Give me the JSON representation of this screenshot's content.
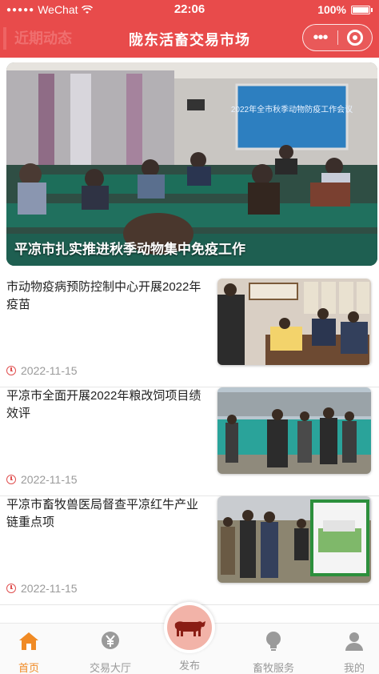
{
  "status_bar": {
    "carrier": "WeChat",
    "time": "22:06",
    "battery": "100%"
  },
  "header": {
    "title": "陇东活畜交易市场",
    "section_tag": "近期动态"
  },
  "hero": {
    "caption": "平凉市扎实推进秋季动物集中免疫工作",
    "screen_text": "2022年全市秋季动物防疫工作会议"
  },
  "news": [
    {
      "title": "市动物疫病预防控制中心开展2022年疫苗",
      "date": "2022-11-15"
    },
    {
      "title": "平凉市全面开展2022年粮改饲项目绩效评",
      "date": "2022-11-15"
    },
    {
      "title": "平凉市畜牧兽医局督查平凉红牛产业链重点项",
      "date": "2022-11-15"
    }
  ],
  "tabbar": {
    "home": "首页",
    "hall": "交易大厅",
    "publish": "发布",
    "service": "畜牧服务",
    "mine": "我的"
  },
  "colors": {
    "brand_red": "#e84b4b",
    "active_tab": "#f08a24",
    "date_icon": "#e05050"
  }
}
